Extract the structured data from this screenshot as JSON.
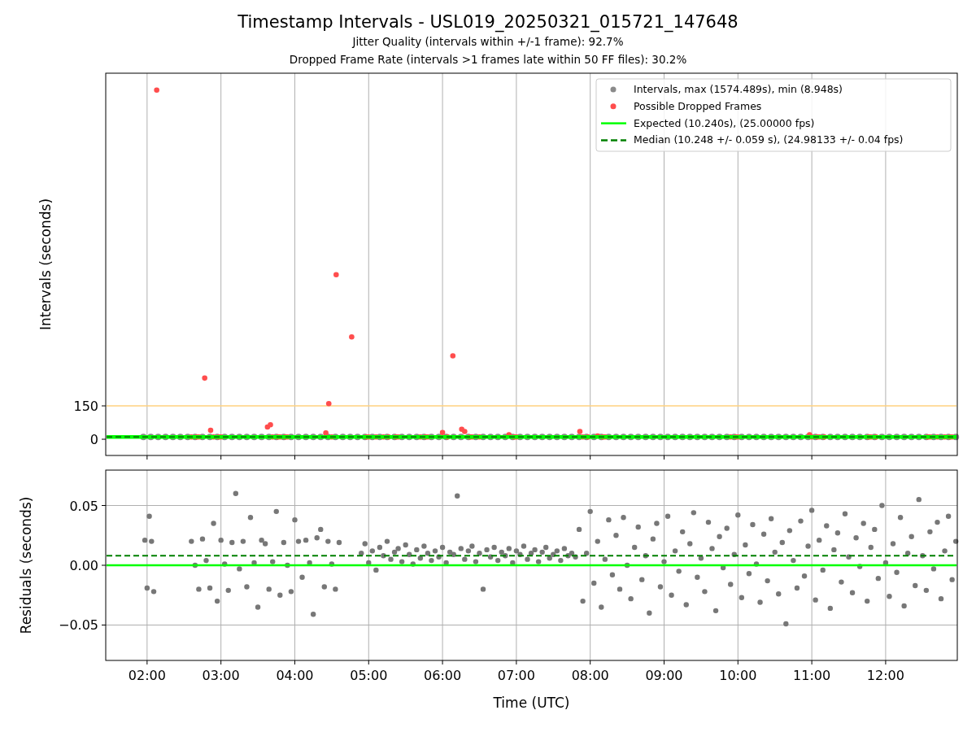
{
  "figure": {
    "title": "Timestamp Intervals - USL019_20250321_015721_147648",
    "subtitles": [
      "Jitter Quality (intervals within +/-1 frame): 92.7%",
      "Dropped Frame Rate (intervals >1 frames late within 50 FF files): 30.2%"
    ],
    "top_panel": {
      "chart_data": {
        "type": "scatter",
        "ylabel": "Intervals (seconds)",
        "xlim": [
          1.44,
          12.97
        ],
        "ylim": [
          -73,
          1646
        ],
        "yticks": [
          {
            "value": 150,
            "label": "150"
          },
          {
            "value": 0,
            "label": "0"
          }
        ],
        "grid": "x",
        "legend": "upper right",
        "ref_lines": [
          {
            "axis": "y",
            "value": 150,
            "color": "#ffd27f"
          },
          {
            "axis": "y",
            "value": 10.24,
            "label": "Expected (10.240s), (25.00000 fps)",
            "color": "#00ff00"
          },
          {
            "axis": "y",
            "value": 10.248,
            "label": "Median (10.248 +/- 0.059 s), (24.98133 +/- 0.04 fps)",
            "color": "#008000"
          }
        ],
        "series": [
          {
            "name": "Intervals, max (1574.489s), min (8.948s)",
            "color": "#8a8a8a",
            "x": [
              1.95,
              2.05,
              2.15,
              2.25,
              2.35,
              2.45,
              2.55,
              2.65,
              2.75,
              2.85,
              2.95,
              3.05,
              3.15,
              3.25,
              3.35,
              3.45,
              3.55,
              3.65,
              3.75,
              3.85,
              3.95,
              4.05,
              4.15,
              4.25,
              4.35,
              4.45,
              4.55,
              4.65,
              4.75,
              4.85,
              4.95,
              5.05,
              5.15,
              5.25,
              5.35,
              5.45,
              5.55,
              5.65,
              5.75,
              5.85,
              5.95,
              6.05,
              6.15,
              6.25,
              6.35,
              6.45,
              6.55,
              6.65,
              6.75,
              6.85,
              6.95,
              7.05,
              7.15,
              7.25,
              7.35,
              7.45,
              7.55,
              7.65,
              7.75,
              7.85,
              7.95,
              8.05,
              8.15,
              8.25,
              8.35,
              8.45,
              8.55,
              8.65,
              8.75,
              8.85,
              8.95,
              9.05,
              9.15,
              9.25,
              9.35,
              9.45,
              9.55,
              9.65,
              9.75,
              9.85,
              9.95,
              10.05,
              10.15,
              10.25,
              10.35,
              10.45,
              10.55,
              10.65,
              10.75,
              10.85,
              10.95,
              11.05,
              11.15,
              11.25,
              11.35,
              11.45,
              11.55,
              11.65,
              11.75,
              11.85,
              11.95,
              12.05,
              12.15,
              12.25,
              12.35,
              12.45,
              12.55,
              12.65,
              12.75,
              12.85,
              12.95
            ],
            "values": [
              10,
              10,
              10,
              10,
              10,
              10,
              10,
              10,
              10,
              10,
              10,
              10,
              10,
              10,
              10,
              10,
              10,
              10,
              10,
              10,
              10,
              10,
              10,
              10,
              10,
              10,
              10,
              10,
              10,
              10,
              10,
              10,
              10,
              10,
              10,
              10,
              10,
              10,
              10,
              10,
              10,
              10,
              10,
              10,
              10,
              10,
              10,
              10,
              10,
              10,
              10,
              10,
              10,
              10,
              10,
              10,
              10,
              10,
              10,
              10,
              10,
              10,
              10,
              10,
              10,
              10,
              10,
              10,
              10,
              10,
              10,
              10,
              10,
              10,
              10,
              10,
              10,
              10,
              10,
              10,
              10,
              10,
              10,
              10,
              10,
              10,
              10,
              10,
              10,
              10,
              10,
              10,
              10,
              10,
              10,
              10,
              10,
              10,
              10,
              10,
              10,
              10,
              10,
              10,
              10,
              10,
              10,
              10,
              10,
              10,
              10
            ]
          },
          {
            "name": "Possible Dropped Frames",
            "color": "#ff4d4d",
            "x": [
              2.13,
              2.78,
              2.86,
              3.63,
              3.67,
              4.42,
              4.46,
              4.56,
              4.77,
              6.0,
              6.14,
              6.26,
              6.3,
              6.9,
              7.86,
              8.1,
              10.97,
              2.6,
              2.67,
              2.7,
              2.9,
              2.97,
              3.0,
              3.7,
              3.77,
              3.8,
              3.87,
              3.9,
              4.5,
              4.97,
              5.0,
              5.1,
              5.2,
              5.27,
              5.37,
              5.4,
              5.7,
              5.77,
              5.8,
              6.07,
              6.37,
              6.4,
              6.5,
              6.97,
              7.0,
              7.9,
              7.97,
              8.17,
              8.2,
              9.9,
              9.97,
              10.0,
              11.0,
              11.07,
              11.1,
              11.17,
              11.77,
              11.8,
              11.87,
              12.57,
              12.6,
              12.7,
              12.8,
              12.87,
              12.9
            ],
            "values": [
              1570,
              275,
              40,
              55,
              65,
              28,
              160,
              740,
              460,
              30,
              375,
              45,
              35,
              20,
              35,
              15,
              20,
              10,
              10,
              10,
              10,
              10,
              10,
              10,
              10,
              10,
              10,
              10,
              10,
              10,
              10,
              10,
              10,
              10,
              10,
              10,
              10,
              10,
              10,
              10,
              10,
              10,
              10,
              10,
              10,
              10,
              10,
              10,
              10,
              10,
              10,
              10,
              10,
              10,
              10,
              10,
              10,
              10,
              10,
              10,
              10,
              10,
              10,
              10,
              10
            ]
          }
        ]
      }
    },
    "bottom_panel": {
      "chart_data": {
        "type": "scatter",
        "xlabel": "Time (UTC)",
        "ylabel": "Residuals (seconds)",
        "xlim": [
          1.44,
          12.97
        ],
        "ylim": [
          -0.0796,
          0.0796
        ],
        "xticks": [
          {
            "value": 2,
            "label": "02:00"
          },
          {
            "value": 3,
            "label": "03:00"
          },
          {
            "value": 4,
            "label": "04:00"
          },
          {
            "value": 5,
            "label": "05:00"
          },
          {
            "value": 6,
            "label": "06:00"
          },
          {
            "value": 7,
            "label": "07:00"
          },
          {
            "value": 8,
            "label": "08:00"
          },
          {
            "value": 9,
            "label": "09:00"
          },
          {
            "value": 10,
            "label": "10:00"
          },
          {
            "value": 11,
            "label": "11:00"
          },
          {
            "value": 12,
            "label": "12:00"
          }
        ],
        "yticks": [
          {
            "value": 0.05,
            "label": "0.05"
          },
          {
            "value": 0,
            "label": "0.00"
          },
          {
            "value": -0.05,
            "label": "−0.05"
          }
        ],
        "grid": "both",
        "ref_lines": [
          {
            "axis": "y",
            "value": 0,
            "color": "#00ff00"
          },
          {
            "axis": "y",
            "value": 0.008,
            "color": "#008000"
          }
        ],
        "series": [
          {
            "color": "#777777",
            "x": [
              1.97,
              2.0,
              2.03,
              2.06,
              2.09,
              2.6,
              2.65,
              2.7,
              2.75,
              2.8,
              2.85,
              2.9,
              2.95,
              3.0,
              3.05,
              3.1,
              3.15,
              3.2,
              3.25,
              3.3,
              3.35,
              3.4,
              3.45,
              3.5,
              3.55,
              3.6,
              3.65,
              3.7,
              3.75,
              3.8,
              3.85,
              3.9,
              3.95,
              4.0,
              4.05,
              4.1,
              4.15,
              4.2,
              4.25,
              4.3,
              4.35,
              4.4,
              4.45,
              4.5,
              4.55,
              4.6,
              4.9,
              4.95,
              5.0,
              5.05,
              5.1,
              5.15,
              5.2,
              5.25,
              5.3,
              5.35,
              5.4,
              5.45,
              5.5,
              5.55,
              5.6,
              5.65,
              5.7,
              5.75,
              5.8,
              5.85,
              5.9,
              5.95,
              6.0,
              6.05,
              6.1,
              6.15,
              6.2,
              6.25,
              6.3,
              6.35,
              6.4,
              6.45,
              6.5,
              6.55,
              6.6,
              6.65,
              6.7,
              6.75,
              6.8,
              6.85,
              6.9,
              6.95,
              7.0,
              7.05,
              7.1,
              7.15,
              7.2,
              7.25,
              7.3,
              7.35,
              7.4,
              7.45,
              7.5,
              7.55,
              7.6,
              7.65,
              7.7,
              7.75,
              7.8,
              7.85,
              7.9,
              7.95,
              8.0,
              8.05,
              8.1,
              8.15,
              8.2,
              8.25,
              8.3,
              8.35,
              8.4,
              8.45,
              8.5,
              8.55,
              8.6,
              8.65,
              8.7,
              8.75,
              8.8,
              8.85,
              8.9,
              8.95,
              9.0,
              9.05,
              9.1,
              9.15,
              9.2,
              9.25,
              9.3,
              9.35,
              9.4,
              9.45,
              9.5,
              9.55,
              9.6,
              9.65,
              9.7,
              9.75,
              9.8,
              9.85,
              9.9,
              9.95,
              10.0,
              10.05,
              10.1,
              10.15,
              10.2,
              10.25,
              10.3,
              10.35,
              10.4,
              10.45,
              10.5,
              10.55,
              10.6,
              10.65,
              10.7,
              10.75,
              10.8,
              10.85,
              10.9,
              10.95,
              11.0,
              11.05,
              11.1,
              11.15,
              11.2,
              11.25,
              11.3,
              11.35,
              11.4,
              11.45,
              11.5,
              11.55,
              11.6,
              11.65,
              11.7,
              11.75,
              11.8,
              11.85,
              11.9,
              11.95,
              12.0,
              12.05,
              12.1,
              12.15,
              12.2,
              12.25,
              12.3,
              12.35,
              12.4,
              12.45,
              12.5,
              12.55,
              12.6,
              12.65,
              12.7,
              12.75,
              12.8,
              12.85,
              12.9,
              12.95
            ],
            "values": [
              0.021,
              -0.019,
              0.041,
              0.02,
              -0.022,
              0.02,
              0,
              -0.02,
              0.022,
              0.004,
              -0.019,
              0.035,
              -0.03,
              0.021,
              0.001,
              -0.021,
              0.019,
              0.06,
              -0.003,
              0.02,
              -0.018,
              0.04,
              0.002,
              -0.035,
              0.021,
              0.018,
              -0.02,
              0.003,
              0.045,
              -0.025,
              0.019,
              0.0,
              -0.022,
              0.038,
              0.02,
              -0.01,
              0.021,
              0.002,
              -0.041,
              0.023,
              0.03,
              -0.018,
              0.02,
              0.001,
              -0.02,
              0.019,
              0.01,
              0.018,
              0.002,
              0.012,
              -0.004,
              0.015,
              0.008,
              0.02,
              0.005,
              0.011,
              0.014,
              0.003,
              0.017,
              0.009,
              0.001,
              0.013,
              0.006,
              0.016,
              0.01,
              0.004,
              0.012,
              0.007,
              0.015,
              0.002,
              0.011,
              0.009,
              0.058,
              0.014,
              0.005,
              0.012,
              0.016,
              0.003,
              0.01,
              -0.02,
              0.013,
              0.007,
              0.015,
              0.004,
              0.011,
              0.008,
              0.014,
              0.002,
              0.012,
              0.009,
              0.016,
              0.005,
              0.01,
              0.013,
              0.003,
              0.011,
              0.015,
              0.006,
              0.009,
              0.012,
              0.004,
              0.014,
              0.008,
              0.01,
              0.007,
              0.03,
              -0.03,
              0.01,
              0.045,
              -0.015,
              0.02,
              -0.035,
              0.005,
              0.038,
              -0.008,
              0.025,
              -0.02,
              0.04,
              0.0,
              -0.028,
              0.015,
              0.032,
              -0.012,
              0.008,
              -0.04,
              0.022,
              0.035,
              -0.018,
              0.003,
              0.041,
              -0.025,
              0.012,
              -0.005,
              0.028,
              -0.033,
              0.018,
              0.044,
              -0.01,
              0.006,
              -0.022,
              0.036,
              0.014,
              -0.038,
              0.024,
              -0.002,
              0.031,
              -0.016,
              0.009,
              0.042,
              -0.027,
              0.017,
              -0.007,
              0.034,
              0.001,
              -0.031,
              0.026,
              -0.013,
              0.039,
              0.011,
              -0.024,
              0.019,
              -0.049,
              0.029,
              0.004,
              -0.019,
              0.037,
              -0.009,
              0.016,
              0.046,
              -0.029,
              0.021,
              -0.004,
              0.033,
              -0.036,
              0.013,
              0.027,
              -0.014,
              0.043,
              0.007,
              -0.023,
              0.023,
              -0.001,
              0.035,
              -0.03,
              0.015,
              0.03,
              -0.011,
              0.05,
              0.002,
              -0.026,
              0.018,
              -0.006,
              0.04,
              -0.034,
              0.01,
              0.024,
              -0.017,
              0.055,
              0.008,
              -0.021,
              0.028,
              -0.003,
              0.036,
              -0.028,
              0.012,
              0.041,
              -0.012,
              0.02
            ]
          }
        ]
      }
    }
  }
}
